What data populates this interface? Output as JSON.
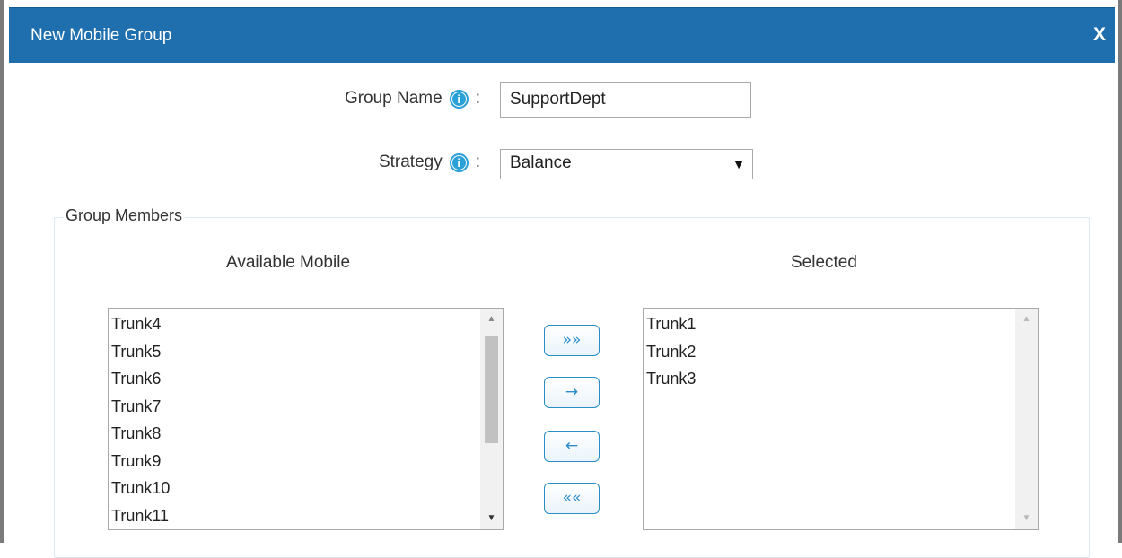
{
  "dialog": {
    "title": "New Mobile Group",
    "close_label": "X"
  },
  "form": {
    "group_name_label": "Group Name",
    "group_name_colon": ":",
    "group_name_value": "SupportDept",
    "strategy_label": "Strategy",
    "strategy_colon": ":",
    "strategy_value": "Balance",
    "info_glyph": "i"
  },
  "members": {
    "legend": "Group Members",
    "available_title": "Available Mobile",
    "selected_title": "Selected",
    "available": [
      "Trunk4",
      "Trunk5",
      "Trunk6",
      "Trunk7",
      "Trunk8",
      "Trunk9",
      "Trunk10",
      "Trunk11"
    ],
    "selected": [
      "Trunk1",
      "Trunk2",
      "Trunk3"
    ],
    "buttons": {
      "add_all": "»»",
      "add": "→",
      "remove": "←",
      "remove_all": "««"
    },
    "available_scroll_fraction": 0.2
  },
  "colors": {
    "titlebar": "#1f6fae",
    "accent": "#2a8dc8",
    "info_icon": "#2a9fd8"
  }
}
